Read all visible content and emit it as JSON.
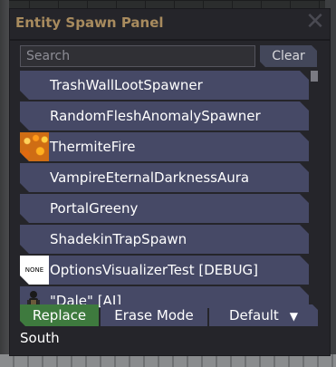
{
  "panel": {
    "title": "Entity Spawn Panel",
    "close_icon": "close-icon"
  },
  "search": {
    "placeholder": "Search",
    "value": "",
    "clear_label": "Clear"
  },
  "entities": [
    {
      "label": "TrashWallLootSpawner",
      "icon": ""
    },
    {
      "label": "RandomFleshAnomalySpawner",
      "icon": ""
    },
    {
      "label": "ThermiteFire",
      "icon": "fire-icon"
    },
    {
      "label": "VampireEternalDarknessAura",
      "icon": ""
    },
    {
      "label": "PortalGreeny",
      "icon": ""
    },
    {
      "label": "ShadekinTrapSpawn",
      "icon": ""
    },
    {
      "label": "OptionsVisualizerTest [DEBUG]",
      "icon": "none-icon",
      "icon_text": "NONE"
    },
    {
      "label": "\"Dale\" [AI]",
      "icon": "dale-icon"
    }
  ],
  "modes": {
    "replace_label": "Replace",
    "erase_label": "Erase Mode",
    "default_label": "Default",
    "default_arrow": "▼"
  },
  "direction": "South",
  "colors": {
    "title": "#a88b5e",
    "item_bg": "#464966",
    "replace_active": "#3e7a3e",
    "panel_bg": "#25252a"
  }
}
